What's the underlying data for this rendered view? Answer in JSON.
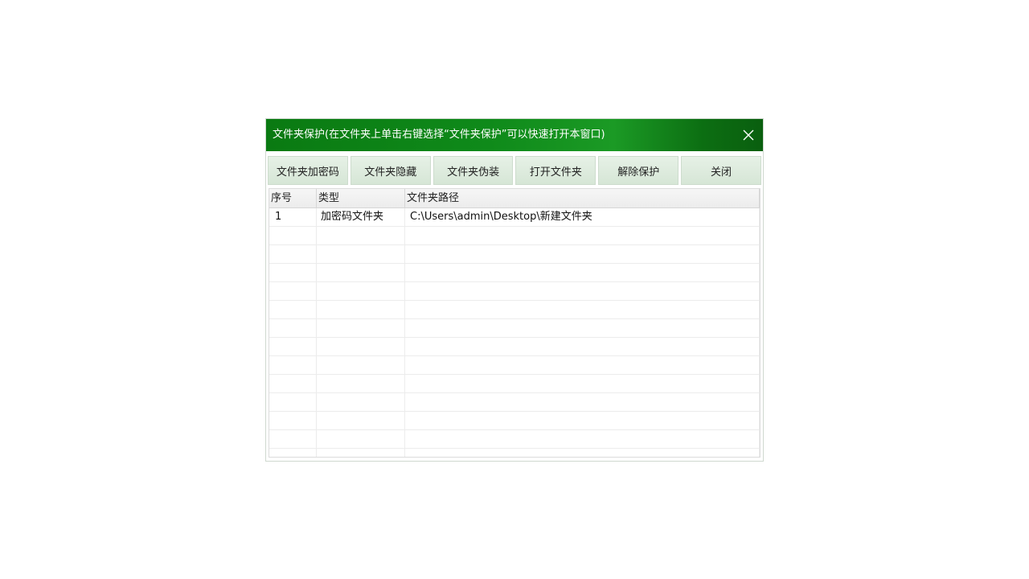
{
  "window": {
    "title": "文件夹保护(在文件夹上单击右键选择“文件夹保护”可以快速打开本窗口)",
    "close_icon": "close-icon"
  },
  "toolbar": {
    "buttons": [
      {
        "label": "文件夹加密码"
      },
      {
        "label": "文件夹隐藏"
      },
      {
        "label": "文件夹伪装"
      },
      {
        "label": "打开文件夹"
      },
      {
        "label": "解除保护"
      },
      {
        "label": "关闭"
      }
    ]
  },
  "table": {
    "headers": [
      "序号",
      "类型",
      "文件夹路径"
    ],
    "rows": [
      {
        "index": "1",
        "type": "加密码文件夹",
        "path": "C:\\Users\\admin\\Desktop\\新建文件夹"
      }
    ]
  },
  "colors": {
    "titlebar": "#0f8a1a",
    "button_bg": "#dcebdc"
  }
}
